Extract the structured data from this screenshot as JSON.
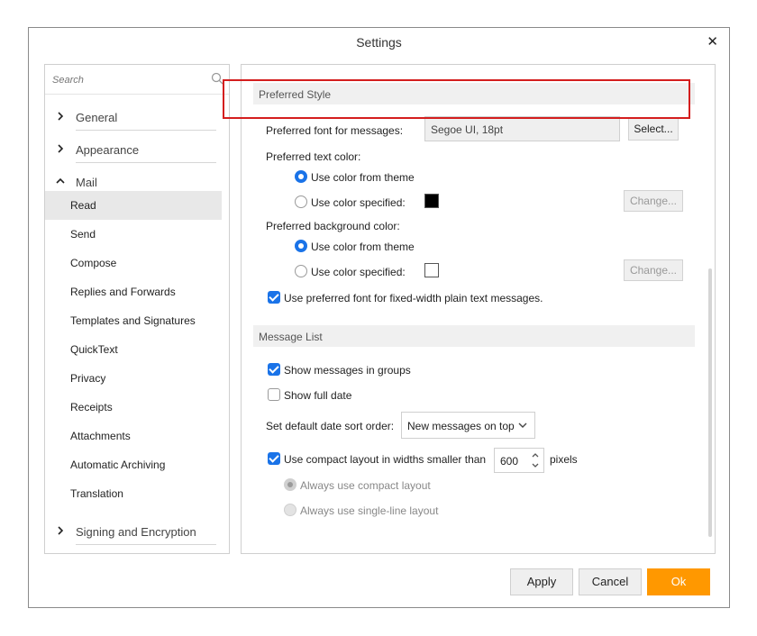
{
  "window": {
    "title": "Settings"
  },
  "sidebar": {
    "search_placeholder": "Search",
    "categories": {
      "general": "General",
      "appearance": "Appearance",
      "mail": "Mail",
      "signing": "Signing and Encryption"
    },
    "mail_items": [
      "Read",
      "Send",
      "Compose",
      "Replies and Forwards",
      "Templates and Signatures",
      "QuickText",
      "Privacy",
      "Receipts",
      "Attachments",
      "Automatic Archiving",
      "Translation"
    ],
    "active_item": "Read"
  },
  "preferred_style": {
    "header": "Preferred Style",
    "font_label": "Preferred font for messages:",
    "font_value": "Segoe UI, 18pt",
    "select_button": "Select...",
    "text_color_label": "Preferred text color:",
    "text_color_theme": "Use color from theme",
    "text_color_specified": "Use color specified:",
    "text_color_swatch": "#000000",
    "change_button": "Change...",
    "bg_color_label": "Preferred background color:",
    "bg_color_theme": "Use color from theme",
    "bg_color_specified": "Use color specified:",
    "bg_color_swatch": "#ffffff",
    "fixed_width_label": "Use preferred font for fixed-width plain text messages."
  },
  "message_list": {
    "header": "Message List",
    "show_groups": "Show messages in groups",
    "show_full_date": "Show full date",
    "sort_label": "Set default date sort order:",
    "sort_value": "New messages on top",
    "compact_label": "Use compact layout in widths smaller than",
    "compact_value": "600",
    "compact_unit": "pixels",
    "always_compact": "Always use compact layout",
    "always_single": "Always use single-line layout"
  },
  "footer": {
    "apply": "Apply",
    "cancel": "Cancel",
    "ok": "Ok"
  },
  "colors": {
    "accent": "#1a73e8",
    "ok_button": "#ff9800",
    "highlight": "#d41e1e"
  }
}
